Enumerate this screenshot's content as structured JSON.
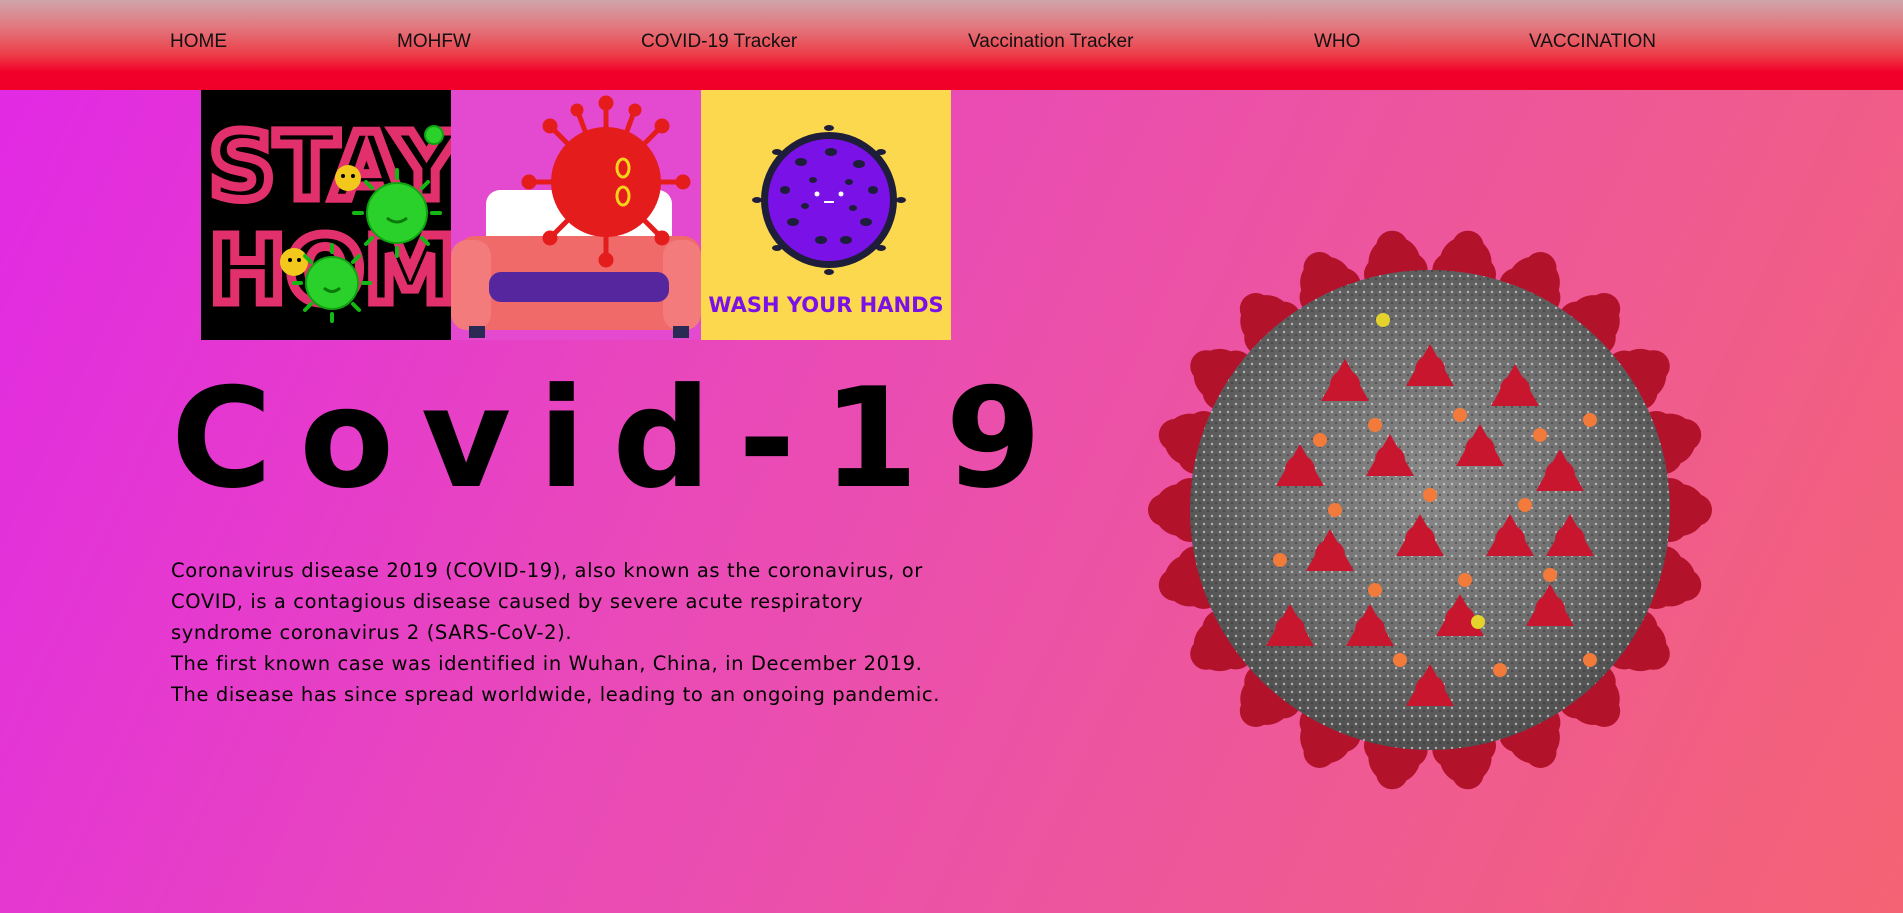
{
  "nav": {
    "items": [
      {
        "label": "HOME"
      },
      {
        "label": "MOHFW"
      },
      {
        "label": "COVID-19 Tracker"
      },
      {
        "label": "Vaccination Tracker"
      },
      {
        "label": "WHO"
      },
      {
        "label": "VACCINATION"
      }
    ]
  },
  "tiles": {
    "stay_home": {
      "line1": "STAY",
      "line2": "HOME"
    },
    "wash_hands": {
      "caption": "WASH YOUR HANDS"
    }
  },
  "hero": {
    "title": "Covid-19",
    "paragraphs": [
      "Coronavirus disease 2019 (COVID-19), also known as the coronavirus, or COVID, is a contagious disease caused by severe acute respiratory syndrome coronavirus 2 (SARS-CoV-2).",
      "The first known case was identified in Wuhan, China, in December 2019.",
      "The disease has since spread worldwide, leading to an ongoing pandemic."
    ]
  },
  "colors": {
    "navbar_red": "#f00028",
    "background_magenta": "#e128e6",
    "background_coral": "#f46374",
    "tile_yellow": "#fcd84f",
    "virus_red": "#b3122b"
  },
  "icons": [
    "stay-home-illustration",
    "virus-on-couch-illustration",
    "wash-hands-illustration",
    "coronavirus-image"
  ]
}
